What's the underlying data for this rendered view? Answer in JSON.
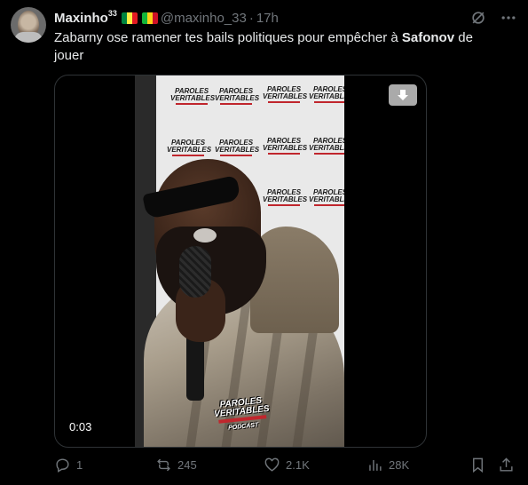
{
  "tweet": {
    "author": {
      "name": "Maxinho",
      "name_sup": "33",
      "handle": "@maxinho_33",
      "separator": "·",
      "time": "17h",
      "flags": [
        {
          "colors": [
            "#00853f",
            "#fdef42",
            "#e31b23"
          ]
        },
        {
          "colors": [
            "#14b53a",
            "#fcd116",
            "#ce1126"
          ]
        }
      ]
    },
    "text": {
      "before": "Zabarny ose ramener tes bails politiques pour empêcher à ",
      "bold": "Safonov",
      "after": " de jouer"
    },
    "media": {
      "duration": "0:03",
      "download_icon": "download-icon",
      "backdrop_logo": {
        "line1": "PAROLES",
        "line2": "VERITABLES",
        "line3": "PODCAST"
      },
      "badge": {
        "line1": "PAROLES",
        "line2": "VERITABLES",
        "line3": "PODCAST"
      }
    },
    "actions": {
      "replies": "1",
      "reposts": "245",
      "likes": "2.1K",
      "views": "28K"
    },
    "colors": {
      "text": "#e7e9ea",
      "muted": "#71767b",
      "background": "#000000",
      "border": "#2f3336"
    }
  }
}
